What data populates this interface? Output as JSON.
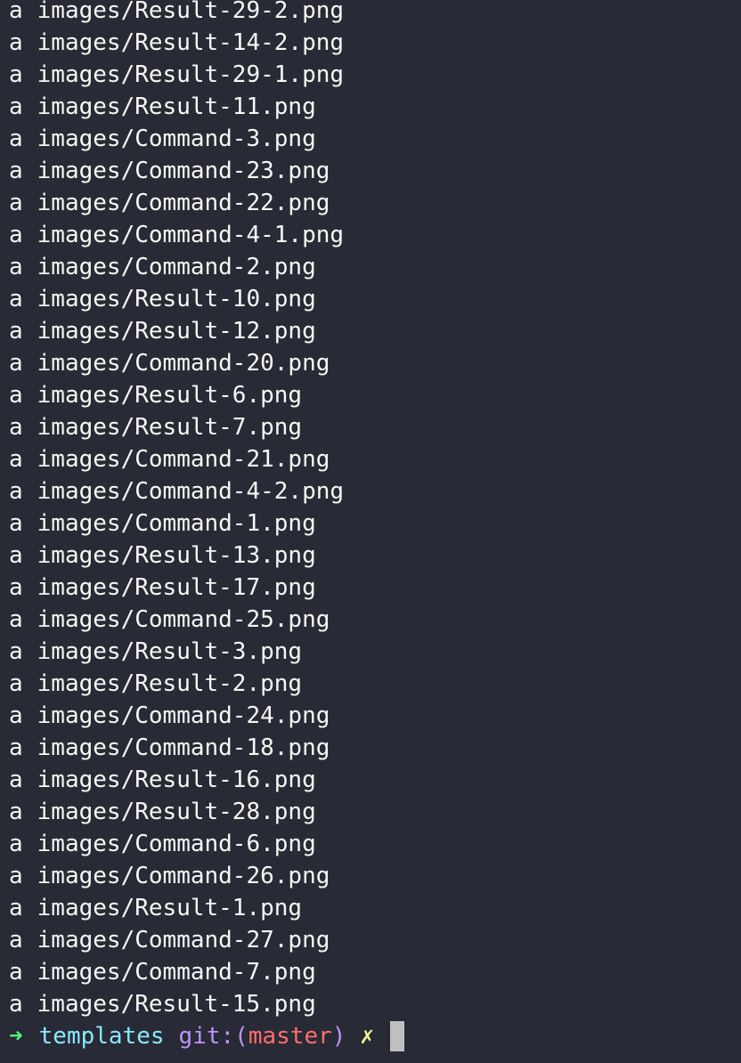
{
  "terminal": {
    "lines": [
      {
        "status": "a",
        "path": "images/Result-29-2.png"
      },
      {
        "status": "a",
        "path": "images/Result-14-2.png"
      },
      {
        "status": "a",
        "path": "images/Result-29-1.png"
      },
      {
        "status": "a",
        "path": "images/Result-11.png"
      },
      {
        "status": "a",
        "path": "images/Command-3.png"
      },
      {
        "status": "a",
        "path": "images/Command-23.png"
      },
      {
        "status": "a",
        "path": "images/Command-22.png"
      },
      {
        "status": "a",
        "path": "images/Command-4-1.png"
      },
      {
        "status": "a",
        "path": "images/Command-2.png"
      },
      {
        "status": "a",
        "path": "images/Result-10.png"
      },
      {
        "status": "a",
        "path": "images/Result-12.png"
      },
      {
        "status": "a",
        "path": "images/Command-20.png"
      },
      {
        "status": "a",
        "path": "images/Result-6.png"
      },
      {
        "status": "a",
        "path": "images/Result-7.png"
      },
      {
        "status": "a",
        "path": "images/Command-21.png"
      },
      {
        "status": "a",
        "path": "images/Command-4-2.png"
      },
      {
        "status": "a",
        "path": "images/Command-1.png"
      },
      {
        "status": "a",
        "path": "images/Result-13.png"
      },
      {
        "status": "a",
        "path": "images/Result-17.png"
      },
      {
        "status": "a",
        "path": "images/Command-25.png"
      },
      {
        "status": "a",
        "path": "images/Result-3.png"
      },
      {
        "status": "a",
        "path": "images/Result-2.png"
      },
      {
        "status": "a",
        "path": "images/Command-24.png"
      },
      {
        "status": "a",
        "path": "images/Command-18.png"
      },
      {
        "status": "a",
        "path": "images/Result-16.png"
      },
      {
        "status": "a",
        "path": "images/Result-28.png"
      },
      {
        "status": "a",
        "path": "images/Command-6.png"
      },
      {
        "status": "a",
        "path": "images/Command-26.png"
      },
      {
        "status": "a",
        "path": "images/Result-1.png"
      },
      {
        "status": "a",
        "path": "images/Command-27.png"
      },
      {
        "status": "a",
        "path": "images/Command-7.png"
      },
      {
        "status": "a",
        "path": "images/Result-15.png"
      }
    ],
    "prompt": {
      "arrow": "➜",
      "directory": "templates",
      "git_label": "git:",
      "paren_open": "(",
      "branch": "master",
      "paren_close": ")",
      "dirty_marker": "✗"
    },
    "colors": {
      "background": "#282a36",
      "foreground": "#f8f8f2",
      "arrow": "#50fa7b",
      "directory": "#8be9fd",
      "git": "#bd93f9",
      "branch": "#ff6e6e",
      "dirty": "#f1fa8c",
      "cursor": "#bfbfbf"
    }
  }
}
